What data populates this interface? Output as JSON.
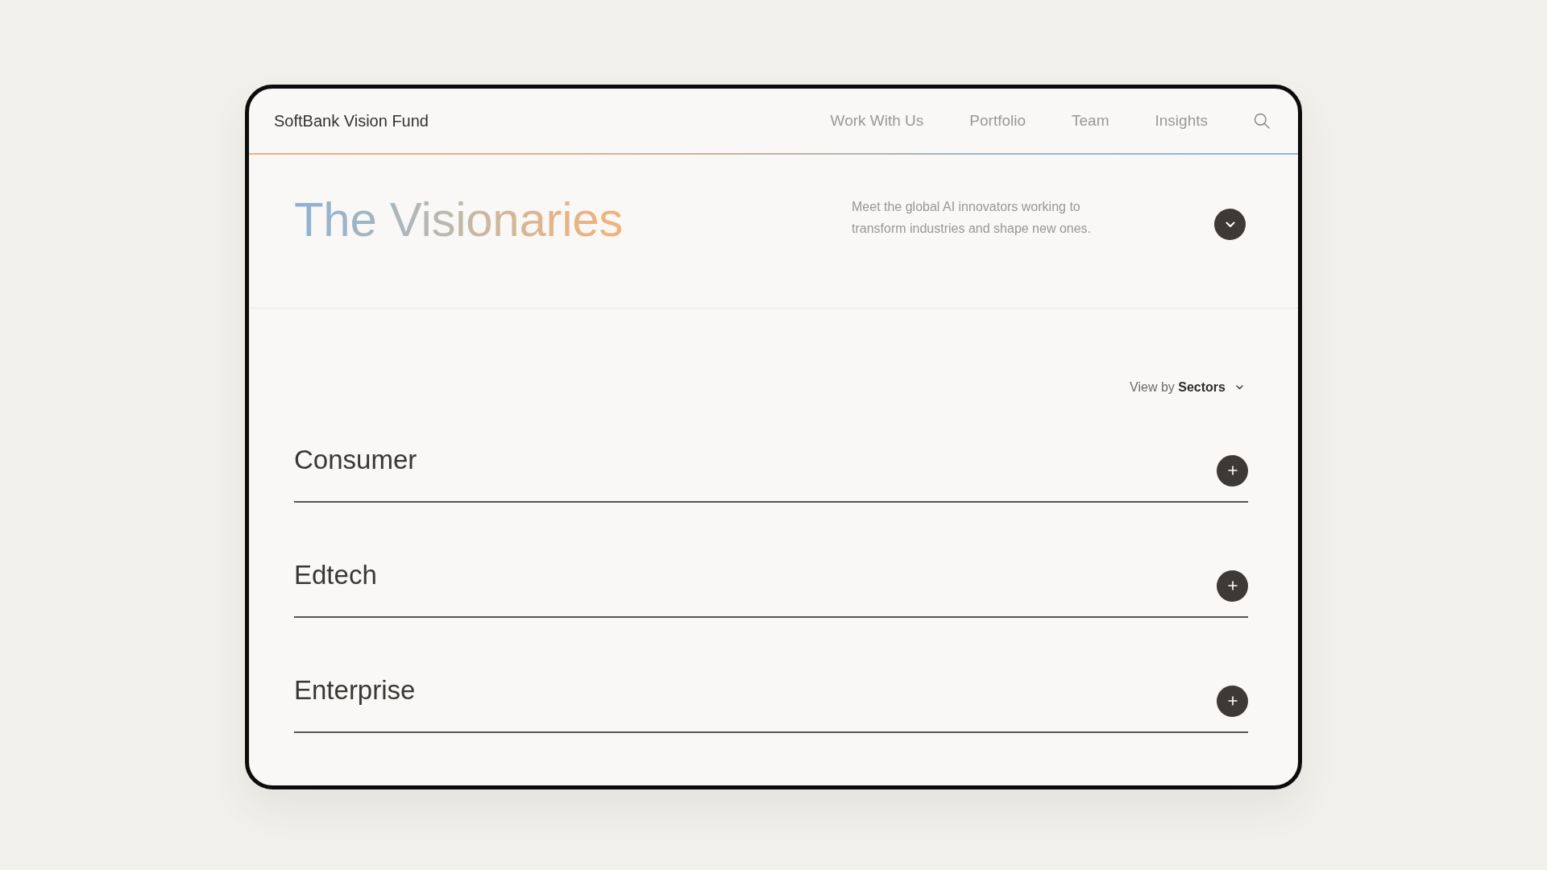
{
  "header": {
    "logo": "SoftBank Vision Fund",
    "nav": [
      {
        "label": "Work With Us"
      },
      {
        "label": "Portfolio"
      },
      {
        "label": "Team"
      },
      {
        "label": "Insights"
      }
    ]
  },
  "hero": {
    "title": "The Visionaries",
    "description": "Meet the global AI innovators working to transform industries and shape new ones."
  },
  "view_by": {
    "label": "View by **Sectors**"
  },
  "sectors": [
    {
      "name": "Consumer",
      "expanded": false
    },
    {
      "name": "Edtech",
      "expanded": false
    },
    {
      "name": "Enterprise",
      "expanded": false
    }
  ]
}
